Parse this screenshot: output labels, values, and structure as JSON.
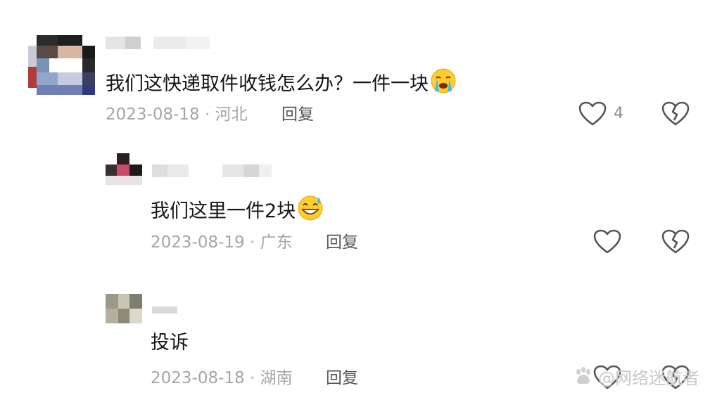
{
  "comments": [
    {
      "text": "我们这快递取件收钱怎么办？一件一块",
      "emoji": "loudly-crying-face",
      "date": "2023-08-18",
      "region": "河北",
      "reply_label": "回复",
      "likes": "4"
    },
    {
      "text": "我们这里一件2块",
      "emoji": "grinning-face-with-sweat",
      "date": "2023-08-19",
      "region": "广东",
      "reply_label": "回复"
    },
    {
      "text": "投诉",
      "date": "2023-08-18",
      "region": "湖南",
      "reply_label": "回复"
    }
  ],
  "separator": "·",
  "watermark": {
    "text": "@网络迷航者",
    "icon": "paw-icon"
  },
  "colors": {
    "text": "#161616",
    "meta": "#a6a6a6",
    "reply": "#555555",
    "icon_stroke": "#555555"
  }
}
